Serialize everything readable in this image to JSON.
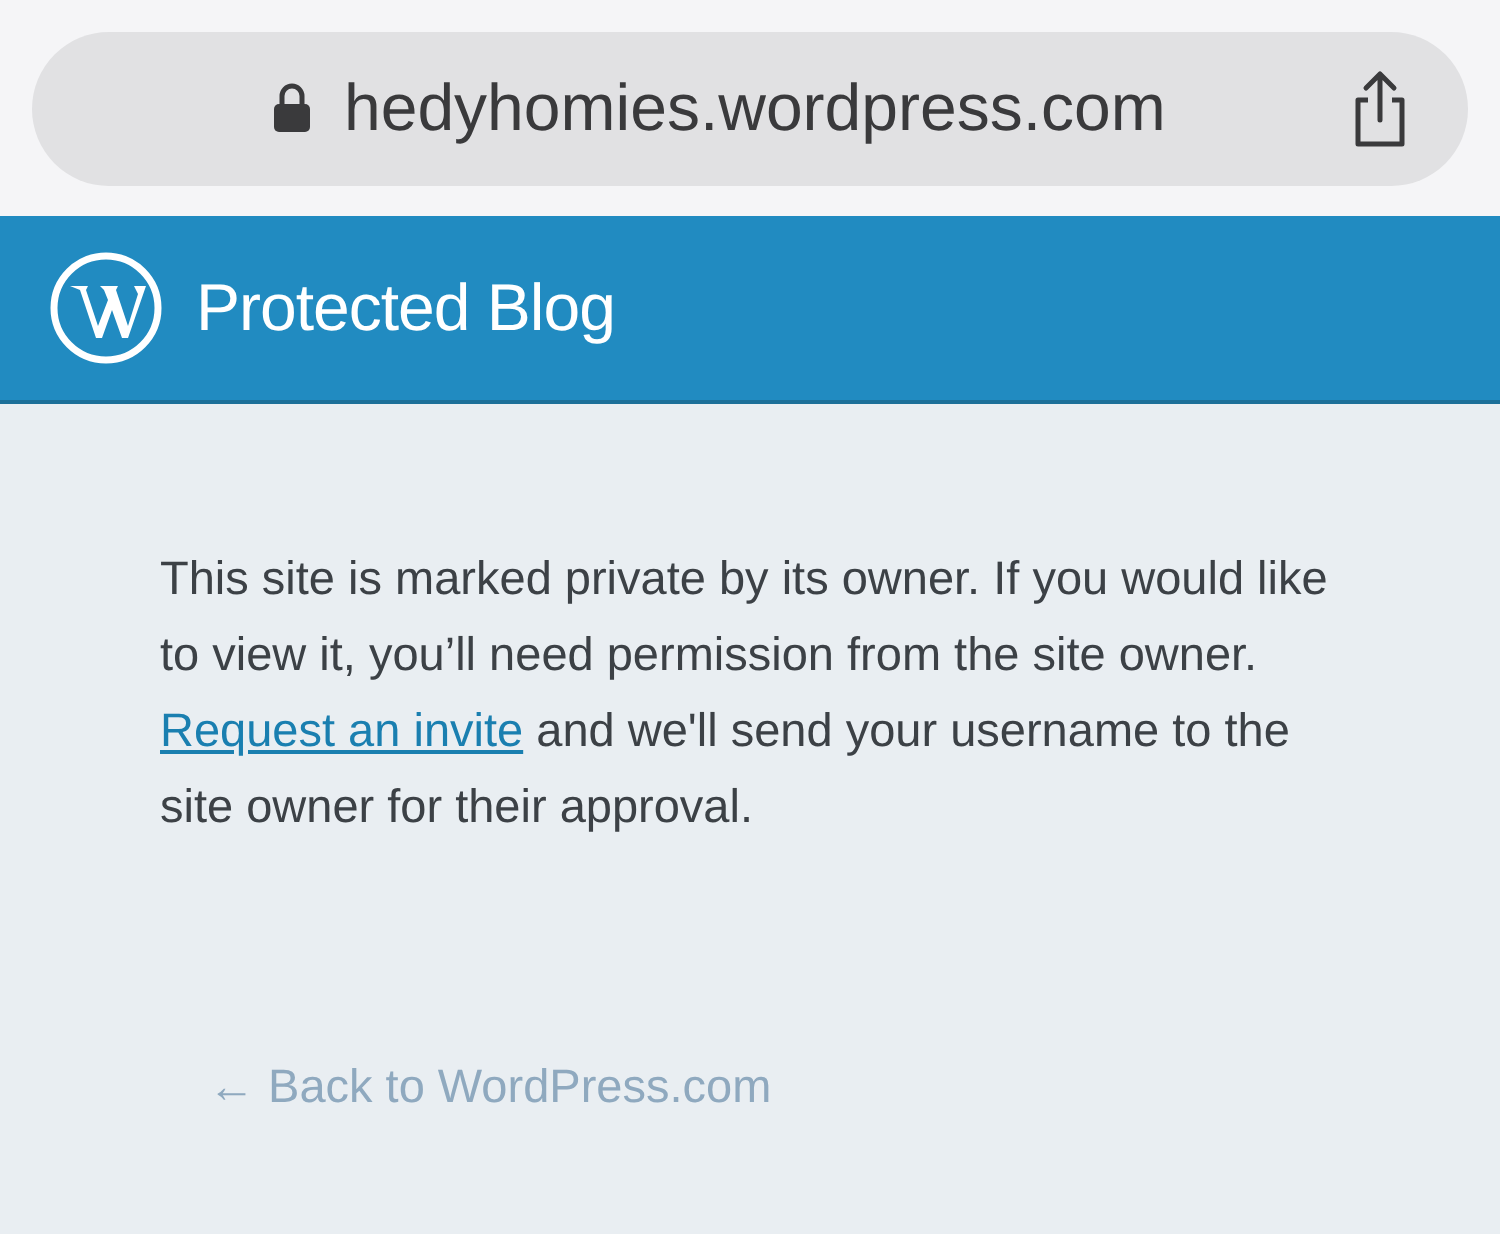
{
  "address_bar": {
    "url": "hedyhomies.wordpress.com",
    "secure": true
  },
  "header": {
    "title": "Protected Blog"
  },
  "message": {
    "before": "This site is marked private by its owner. If you would like to view it, you’ll need permission from the site owner. ",
    "link": "Request an invite",
    "after": " and we'll send your username to the site owner for their approval."
  },
  "back_link": "← Back to WordPress.com"
}
